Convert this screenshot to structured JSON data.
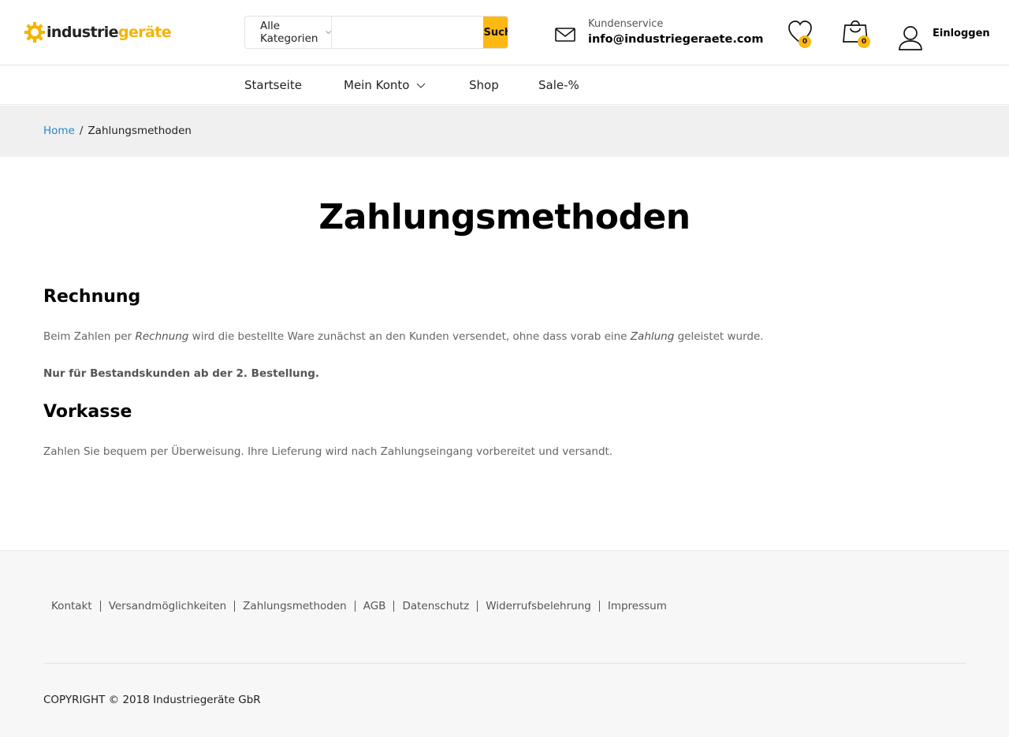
{
  "header": {
    "logo": {
      "part1": "industrie",
      "part2": "geräte"
    },
    "search": {
      "category_selected": "Alle Kategorien",
      "input_value": "",
      "button_label": "Suchen"
    },
    "service": {
      "label": "Kundenservice",
      "email": "info@industriegeraete.com"
    },
    "wishlist_count": "0",
    "cart_count": "0",
    "login_label": "Einloggen"
  },
  "nav": {
    "items": [
      {
        "label": "Startseite"
      },
      {
        "label": "Mein Konto"
      },
      {
        "label": "Shop"
      },
      {
        "label": "Sale-%"
      }
    ]
  },
  "breadcrumb": {
    "home": "Home",
    "separator": "/",
    "current": "Zahlungsmethoden"
  },
  "main": {
    "title": "Zahlungsmethoden",
    "sections": [
      {
        "heading": "Rechnung",
        "text_parts": [
          "Beim Zahlen per ",
          "Rechnung",
          " wird die bestellte Ware zunächst an den Kunden versendet, ohne dass vorab eine ",
          "Zahlung",
          " geleistet wurde."
        ],
        "note": "Nur für Bestandskunden ab der 2. Bestellung."
      },
      {
        "heading": "Vorkasse",
        "text": "Zahlen Sie bequem per Überweisung. Ihre Lieferung wird nach Zahlungseingang vorbereitet und versandt."
      }
    ]
  },
  "footer": {
    "links": [
      "Kontakt",
      "Versandmöglichkeiten",
      "Zahlungsmethoden",
      "AGB",
      "Datenschutz",
      "Widerrufsbelehrung",
      "Impressum"
    ],
    "copyright": "COPYRIGHT © 2018 Industriegeräte GbR"
  },
  "colors": {
    "accent": "#fdb813",
    "link": "#2a87c8",
    "breadcrumb_bg": "#f0f0f0",
    "footer_bg": "#f7f7f7"
  }
}
